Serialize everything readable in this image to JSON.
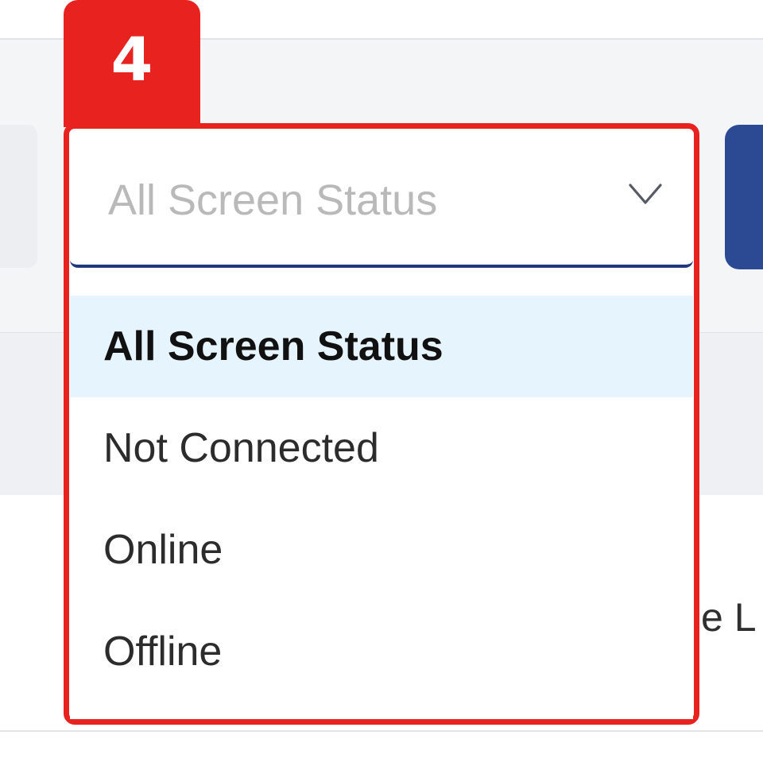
{
  "step": {
    "number": "4"
  },
  "colors": {
    "highlight": "#e8221f",
    "select_border": "#1f3a7a",
    "selected_option_bg": "#e6f4fd",
    "primary_button": "#2b4a93"
  },
  "status_filter": {
    "placeholder": "All Screen Status",
    "icon": "chevron-down-icon",
    "options": [
      {
        "label": "All Screen Status",
        "selected": true
      },
      {
        "label": "Not Connected",
        "selected": false
      },
      {
        "label": "Online",
        "selected": false
      },
      {
        "label": "Offline",
        "selected": false
      }
    ]
  },
  "table": {
    "partial_cell_text": "e L"
  }
}
